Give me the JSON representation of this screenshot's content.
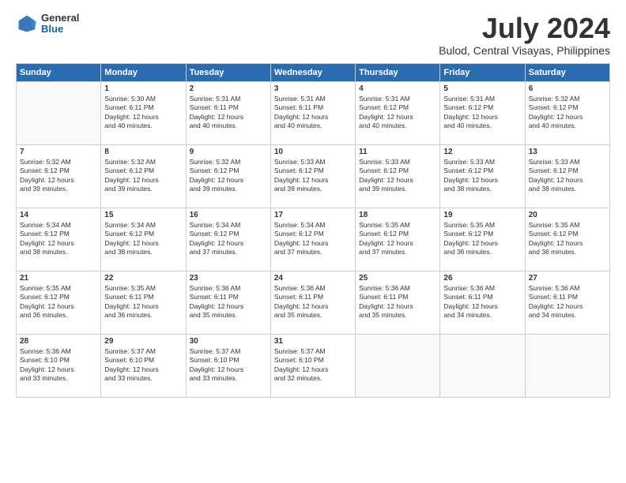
{
  "logo": {
    "general": "General",
    "blue": "Blue"
  },
  "title": "July 2024",
  "subtitle": "Bulod, Central Visayas, Philippines",
  "weekdays": [
    "Sunday",
    "Monday",
    "Tuesday",
    "Wednesday",
    "Thursday",
    "Friday",
    "Saturday"
  ],
  "weeks": [
    [
      {
        "day": "",
        "sunrise": "",
        "sunset": "",
        "daylight": ""
      },
      {
        "day": "1",
        "sunrise": "Sunrise: 5:30 AM",
        "sunset": "Sunset: 6:11 PM",
        "daylight": "Daylight: 12 hours and 40 minutes."
      },
      {
        "day": "2",
        "sunrise": "Sunrise: 5:31 AM",
        "sunset": "Sunset: 6:11 PM",
        "daylight": "Daylight: 12 hours and 40 minutes."
      },
      {
        "day": "3",
        "sunrise": "Sunrise: 5:31 AM",
        "sunset": "Sunset: 6:11 PM",
        "daylight": "Daylight: 12 hours and 40 minutes."
      },
      {
        "day": "4",
        "sunrise": "Sunrise: 5:31 AM",
        "sunset": "Sunset: 6:12 PM",
        "daylight": "Daylight: 12 hours and 40 minutes."
      },
      {
        "day": "5",
        "sunrise": "Sunrise: 5:31 AM",
        "sunset": "Sunset: 6:12 PM",
        "daylight": "Daylight: 12 hours and 40 minutes."
      },
      {
        "day": "6",
        "sunrise": "Sunrise: 5:32 AM",
        "sunset": "Sunset: 6:12 PM",
        "daylight": "Daylight: 12 hours and 40 minutes."
      }
    ],
    [
      {
        "day": "7",
        "sunrise": "Sunrise: 5:32 AM",
        "sunset": "Sunset: 6:12 PM",
        "daylight": "Daylight: 12 hours and 39 minutes."
      },
      {
        "day": "8",
        "sunrise": "Sunrise: 5:32 AM",
        "sunset": "Sunset: 6:12 PM",
        "daylight": "Daylight: 12 hours and 39 minutes."
      },
      {
        "day": "9",
        "sunrise": "Sunrise: 5:32 AM",
        "sunset": "Sunset: 6:12 PM",
        "daylight": "Daylight: 12 hours and 39 minutes."
      },
      {
        "day": "10",
        "sunrise": "Sunrise: 5:33 AM",
        "sunset": "Sunset: 6:12 PM",
        "daylight": "Daylight: 12 hours and 39 minutes."
      },
      {
        "day": "11",
        "sunrise": "Sunrise: 5:33 AM",
        "sunset": "Sunset: 6:12 PM",
        "daylight": "Daylight: 12 hours and 39 minutes."
      },
      {
        "day": "12",
        "sunrise": "Sunrise: 5:33 AM",
        "sunset": "Sunset: 6:12 PM",
        "daylight": "Daylight: 12 hours and 38 minutes."
      },
      {
        "day": "13",
        "sunrise": "Sunrise: 5:33 AM",
        "sunset": "Sunset: 6:12 PM",
        "daylight": "Daylight: 12 hours and 38 minutes."
      }
    ],
    [
      {
        "day": "14",
        "sunrise": "Sunrise: 5:34 AM",
        "sunset": "Sunset: 6:12 PM",
        "daylight": "Daylight: 12 hours and 38 minutes."
      },
      {
        "day": "15",
        "sunrise": "Sunrise: 5:34 AM",
        "sunset": "Sunset: 6:12 PM",
        "daylight": "Daylight: 12 hours and 38 minutes."
      },
      {
        "day": "16",
        "sunrise": "Sunrise: 5:34 AM",
        "sunset": "Sunset: 6:12 PM",
        "daylight": "Daylight: 12 hours and 37 minutes."
      },
      {
        "day": "17",
        "sunrise": "Sunrise: 5:34 AM",
        "sunset": "Sunset: 6:12 PM",
        "daylight": "Daylight: 12 hours and 37 minutes."
      },
      {
        "day": "18",
        "sunrise": "Sunrise: 5:35 AM",
        "sunset": "Sunset: 6:12 PM",
        "daylight": "Daylight: 12 hours and 37 minutes."
      },
      {
        "day": "19",
        "sunrise": "Sunrise: 5:35 AM",
        "sunset": "Sunset: 6:12 PM",
        "daylight": "Daylight: 12 hours and 36 minutes."
      },
      {
        "day": "20",
        "sunrise": "Sunrise: 5:35 AM",
        "sunset": "Sunset: 6:12 PM",
        "daylight": "Daylight: 12 hours and 36 minutes."
      }
    ],
    [
      {
        "day": "21",
        "sunrise": "Sunrise: 5:35 AM",
        "sunset": "Sunset: 6:12 PM",
        "daylight": "Daylight: 12 hours and 36 minutes."
      },
      {
        "day": "22",
        "sunrise": "Sunrise: 5:35 AM",
        "sunset": "Sunset: 6:11 PM",
        "daylight": "Daylight: 12 hours and 36 minutes."
      },
      {
        "day": "23",
        "sunrise": "Sunrise: 5:36 AM",
        "sunset": "Sunset: 6:11 PM",
        "daylight": "Daylight: 12 hours and 35 minutes."
      },
      {
        "day": "24",
        "sunrise": "Sunrise: 5:36 AM",
        "sunset": "Sunset: 6:11 PM",
        "daylight": "Daylight: 12 hours and 35 minutes."
      },
      {
        "day": "25",
        "sunrise": "Sunrise: 5:36 AM",
        "sunset": "Sunset: 6:11 PM",
        "daylight": "Daylight: 12 hours and 35 minutes."
      },
      {
        "day": "26",
        "sunrise": "Sunrise: 5:36 AM",
        "sunset": "Sunset: 6:11 PM",
        "daylight": "Daylight: 12 hours and 34 minutes."
      },
      {
        "day": "27",
        "sunrise": "Sunrise: 5:36 AM",
        "sunset": "Sunset: 6:11 PM",
        "daylight": "Daylight: 12 hours and 34 minutes."
      }
    ],
    [
      {
        "day": "28",
        "sunrise": "Sunrise: 5:36 AM",
        "sunset": "Sunset: 6:10 PM",
        "daylight": "Daylight: 12 hours and 33 minutes."
      },
      {
        "day": "29",
        "sunrise": "Sunrise: 5:37 AM",
        "sunset": "Sunset: 6:10 PM",
        "daylight": "Daylight: 12 hours and 33 minutes."
      },
      {
        "day": "30",
        "sunrise": "Sunrise: 5:37 AM",
        "sunset": "Sunset: 6:10 PM",
        "daylight": "Daylight: 12 hours and 33 minutes."
      },
      {
        "day": "31",
        "sunrise": "Sunrise: 5:37 AM",
        "sunset": "Sunset: 6:10 PM",
        "daylight": "Daylight: 12 hours and 32 minutes."
      },
      {
        "day": "",
        "sunrise": "",
        "sunset": "",
        "daylight": ""
      },
      {
        "day": "",
        "sunrise": "",
        "sunset": "",
        "daylight": ""
      },
      {
        "day": "",
        "sunrise": "",
        "sunset": "",
        "daylight": ""
      }
    ]
  ]
}
